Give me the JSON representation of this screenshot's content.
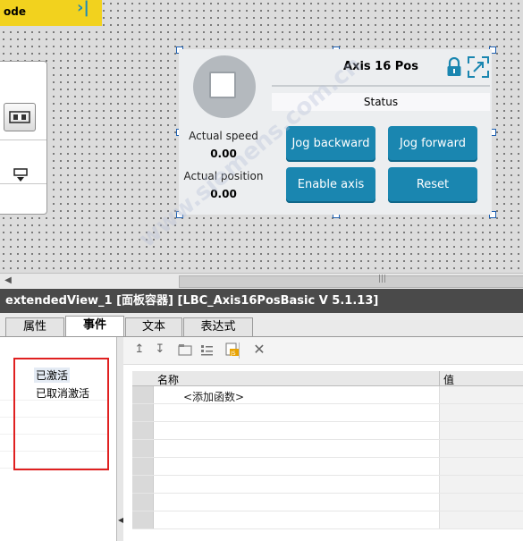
{
  "canvas": {
    "yellow_tab_label": "ode",
    "yellow_tab_icon": "collapse-right-icon"
  },
  "faceplate": {
    "title": "Axis 16 Pos",
    "status": "Status",
    "actual_speed_label": "Actual speed",
    "actual_speed_value": "0.00",
    "actual_position_label": "Actual position",
    "actual_position_value": "0.00",
    "buttons": {
      "jog_backward": "Jog backward",
      "jog_forward": "Jog forward",
      "enable_axis": "Enable axis",
      "reset": "Reset"
    },
    "accent": "#1a86b0"
  },
  "inspector": {
    "title": "extendedView_1 [面板容器] [LBC_Axis16PosBasic V 5.1.13]",
    "tabs": [
      "属性",
      "事件",
      "文本",
      "表达式"
    ],
    "active_tab": "事件",
    "events": [
      "已激活",
      "已取消激活"
    ],
    "grid_headers": {
      "name": "名称",
      "value": "值"
    },
    "add_function": "<添加函数>"
  },
  "watermark": "www.siemens.com.cn"
}
